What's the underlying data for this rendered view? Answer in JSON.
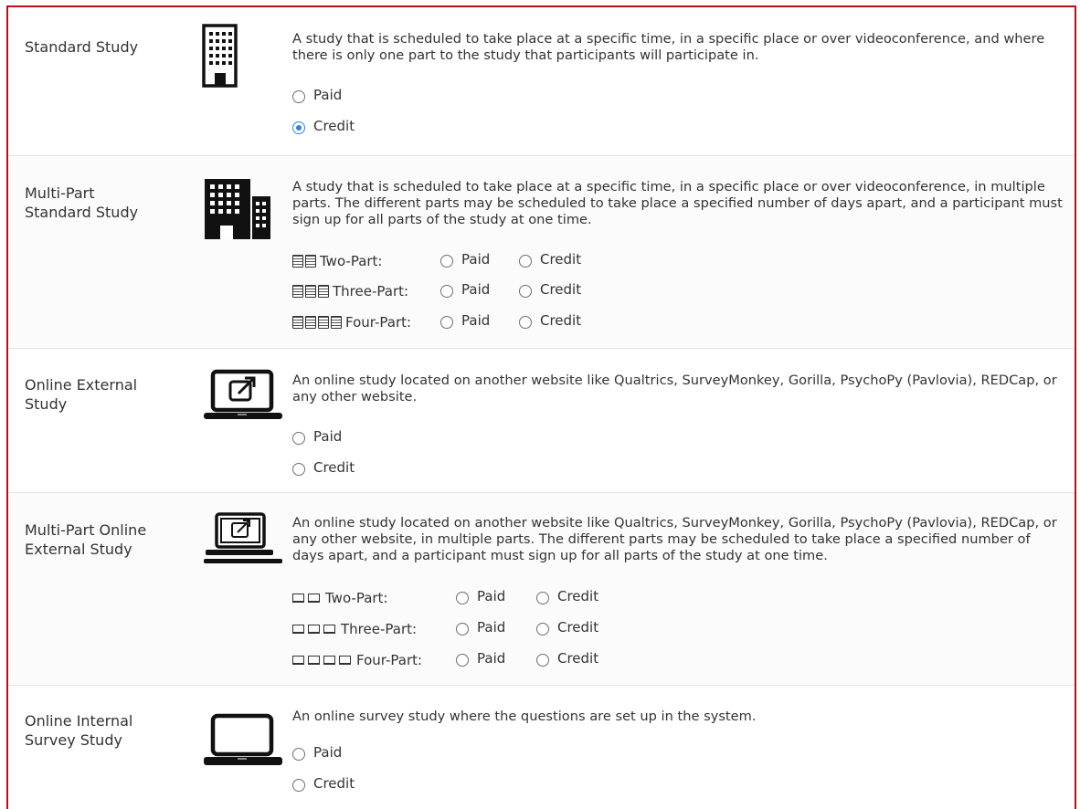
{
  "study_types": [
    {
      "title_line1": "Standard Study",
      "icon": "building-icon",
      "description": "A study that is scheduled to take place at a specific time, in a specific place or over videoconference, and where there is only one part to the study that participants will participate in.",
      "options": [
        {
          "label": "Paid",
          "checked": false
        },
        {
          "label": "Credit",
          "checked": true
        }
      ]
    },
    {
      "title_line1": "Multi-Part",
      "title_line2": "Standard Study",
      "icon": "buildings-icon",
      "description": "A study that is scheduled to take place at a specific time, in a specific place or over videoconference, in multiple parts. The different parts may be scheduled to take place a specified number of days apart, and a participant must sign up for all parts of the study at one time.",
      "parts": [
        {
          "label": "Two-Part:",
          "paid": "Paid",
          "credit": "Credit"
        },
        {
          "label": "Three-Part:",
          "paid": "Paid",
          "credit": "Credit"
        },
        {
          "label": "Four-Part:",
          "paid": "Paid",
          "credit": "Credit"
        }
      ]
    },
    {
      "title_line1": "Online External",
      "title_line2": "Study",
      "icon": "laptop-external-link-icon",
      "description": "An online study located on another website like Qualtrics, SurveyMonkey, Gorilla, PsychoPy (Pavlovia), REDCap, or any other website.",
      "options": [
        {
          "label": "Paid",
          "checked": false
        },
        {
          "label": "Credit",
          "checked": false
        }
      ]
    },
    {
      "title_line1": "Multi-Part Online",
      "title_line2": "External Study",
      "icon": "laptops-external-link-icon",
      "description": "An online study located on another website like Qualtrics, SurveyMonkey, Gorilla, PsychoPy (Pavlovia), REDCap, or any other website, in multiple parts. The different parts may be scheduled to take place a specified number of days apart, and a participant must sign up for all parts of the study at one time.",
      "parts": [
        {
          "label": "Two-Part:",
          "paid": "Paid",
          "credit": "Credit"
        },
        {
          "label": "Three-Part:",
          "paid": "Paid",
          "credit": "Credit"
        },
        {
          "label": "Four-Part:",
          "paid": "Paid",
          "credit": "Credit"
        }
      ]
    },
    {
      "title_line1": "Online Internal",
      "title_line2": "Survey Study",
      "icon": "laptop-icon",
      "description": "An online survey study where the questions are set up in the system.",
      "options": [
        {
          "label": "Paid",
          "checked": false
        },
        {
          "label": "Credit",
          "checked": false
        }
      ]
    }
  ],
  "colors": {
    "frame_border": "#b5121b",
    "radio_selected": "#2f80ed"
  }
}
